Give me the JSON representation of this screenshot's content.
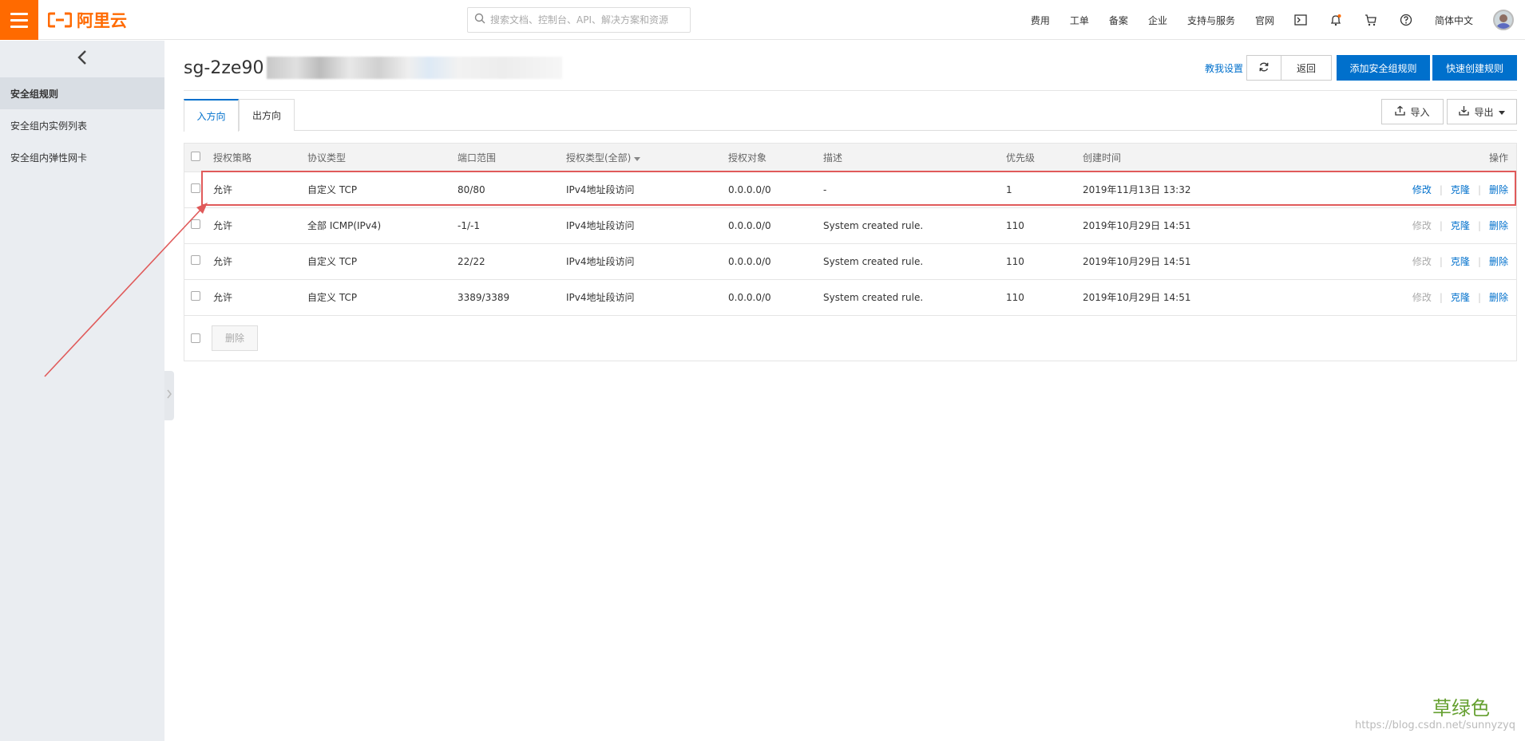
{
  "topbar": {
    "brand": "阿里云",
    "search_placeholder": "搜索文档、控制台、API、解决方案和资源",
    "nav": [
      "费用",
      "工单",
      "备案",
      "企业",
      "支持与服务",
      "官网"
    ],
    "language": "简体中文"
  },
  "sidebar": {
    "items": [
      {
        "label": "安全组规则"
      },
      {
        "label": "安全组内实例列表"
      },
      {
        "label": "安全组内弹性网卡"
      }
    ]
  },
  "header": {
    "title_prefix": "sg-2ze90",
    "help_link": "教我设置",
    "back": "返回",
    "add_rule": "添加安全组规则",
    "quick_create": "快速创建规则"
  },
  "tabs": {
    "items": [
      "入方向",
      "出方向"
    ],
    "import": "导入",
    "export": "导出"
  },
  "table": {
    "columns": [
      "授权策略",
      "协议类型",
      "端口范围",
      "授权类型(全部)",
      "授权对象",
      "描述",
      "优先级",
      "创建时间",
      "操作"
    ],
    "rows": [
      {
        "policy": "允许",
        "protocol": "自定义 TCP",
        "port": "80/80",
        "auth_type": "IPv4地址段访问",
        "target": "0.0.0.0/0",
        "desc": "-",
        "priority": "1",
        "created": "2019年11月13日 13:32",
        "edit_enabled": true
      },
      {
        "policy": "允许",
        "protocol": "全部 ICMP(IPv4)",
        "port": "-1/-1",
        "auth_type": "IPv4地址段访问",
        "target": "0.0.0.0/0",
        "desc": "System created rule.",
        "priority": "110",
        "created": "2019年10月29日 14:51",
        "edit_enabled": false
      },
      {
        "policy": "允许",
        "protocol": "自定义 TCP",
        "port": "22/22",
        "auth_type": "IPv4地址段访问",
        "target": "0.0.0.0/0",
        "desc": "System created rule.",
        "priority": "110",
        "created": "2019年10月29日 14:51",
        "edit_enabled": false
      },
      {
        "policy": "允许",
        "protocol": "自定义 TCP",
        "port": "3389/3389",
        "auth_type": "IPv4地址段访问",
        "target": "0.0.0.0/0",
        "desc": "System created rule.",
        "priority": "110",
        "created": "2019年10月29日 14:51",
        "edit_enabled": false
      }
    ],
    "actions": {
      "edit": "修改",
      "clone": "克隆",
      "delete": "删除"
    },
    "bulk_delete": "删除"
  },
  "watermark": "https://blog.csdn.net/sunnyzyq",
  "stamp": "草绿色",
  "colors": {
    "brand": "#ff6a00",
    "primary": "#0070cc",
    "annotation": "#e05a5a"
  }
}
